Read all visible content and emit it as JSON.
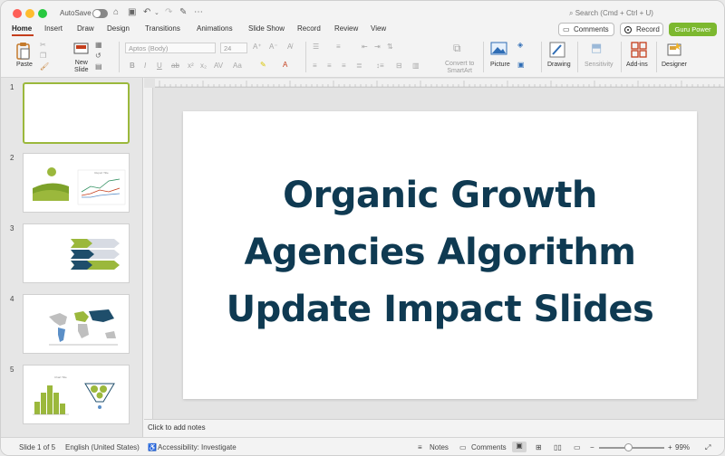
{
  "titlebar": {
    "autosave_label": "AutoSave",
    "search_placeholder": "Search (Cmd + Ctrl + U)"
  },
  "tabs": [
    "Home",
    "Insert",
    "Draw",
    "Design",
    "Transitions",
    "Animations",
    "Slide Show",
    "Record",
    "Review",
    "View"
  ],
  "active_tab": "Home",
  "header_buttons": {
    "comments": "Comments",
    "record": "Record",
    "guru": "Guru Power"
  },
  "ribbon": {
    "paste": "Paste",
    "new_slide_line1": "New",
    "new_slide_line2": "Slide",
    "font_name": "Aptos (Body)",
    "font_size": "24",
    "convert_line1": "Convert to",
    "convert_line2": "SmartArt",
    "picture": "Picture",
    "drawing": "Drawing",
    "sensitivity": "Sensitivity",
    "addins": "Add-ins",
    "designer": "Designer"
  },
  "slides": [
    {
      "num": "1"
    },
    {
      "num": "2",
      "chart_title": "Report Title"
    },
    {
      "num": "3"
    },
    {
      "num": "4"
    },
    {
      "num": "5",
      "chart_title": "Chart Title"
    }
  ],
  "current_slide": {
    "title_lines": [
      "Organic Growth",
      "Agencies Algorithm",
      "Update Impact Slides"
    ]
  },
  "notes_placeholder": "Click to add notes",
  "status": {
    "slide_of": "Slide 1 of 5",
    "language": "English (United States)",
    "accessibility": "Accessibility: Investigate",
    "notes": "Notes",
    "comments": "Comments",
    "zoom": "99%"
  },
  "colors": {
    "accent_green": "#9bb83c",
    "brand_red": "#c43e1c",
    "title_navy": "#0f3a52",
    "guru_green": "#7cb82f"
  }
}
